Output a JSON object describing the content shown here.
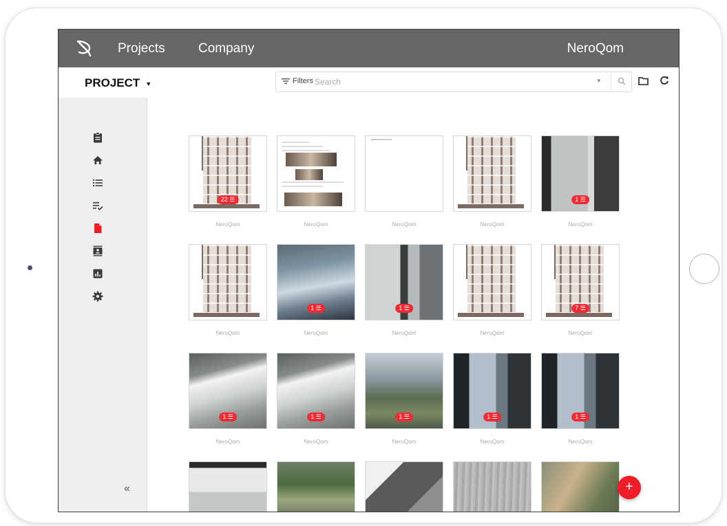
{
  "topbar": {
    "nav": [
      {
        "label": "Projects"
      },
      {
        "label": "Company"
      }
    ],
    "user": "NeroQom"
  },
  "toolbar": {
    "project_label": "PROJECT",
    "filters_label": "Filters",
    "search_placeholder": "Search"
  },
  "sidebar": {
    "icons": [
      "clipboard-icon",
      "home-icon",
      "list-icon",
      "checklist-icon",
      "document-icon",
      "contact-card-icon",
      "chart-icon",
      "gear-icon"
    ],
    "active_icon": "document-icon",
    "collapse_label": "«"
  },
  "grid": {
    "rows": [
      [
        {
          "type": "facade",
          "badge": "22",
          "label": "NeroQom"
        },
        {
          "type": "doc",
          "badge": "",
          "label": "NeroQom"
        },
        {
          "type": "blank",
          "badge": "",
          "label": "NeroQom"
        },
        {
          "type": "facade",
          "badge": "",
          "label": "NeroQom"
        },
        {
          "type": "photo-glass",
          "badge": "1",
          "label": "NeroQom"
        }
      ],
      [
        {
          "type": "facade",
          "badge": "",
          "label": "NeroQom"
        },
        {
          "type": "photo-water",
          "badge": "1",
          "label": "NeroQom"
        },
        {
          "type": "photo-frame",
          "badge": "1",
          "label": "NeroQom"
        },
        {
          "type": "facade",
          "badge": "",
          "label": "NeroQom"
        },
        {
          "type": "facade",
          "badge": "7",
          "label": "NeroQom"
        }
      ],
      [
        {
          "type": "photo-ledge",
          "badge": "1",
          "label": "NeroQom"
        },
        {
          "type": "photo-ledge",
          "badge": "1",
          "label": "NeroQom"
        },
        {
          "type": "photo-window",
          "badge": "1",
          "label": "NeroQom"
        },
        {
          "type": "photo-sky",
          "badge": "1",
          "label": "NeroQom"
        },
        {
          "type": "photo-sky",
          "badge": "1",
          "label": "NeroQom"
        }
      ],
      [
        {
          "type": "photo-metal",
          "badge": "",
          "label": ""
        },
        {
          "type": "photo-green",
          "badge": "",
          "label": ""
        },
        {
          "type": "photo-dark",
          "badge": "",
          "label": ""
        },
        {
          "type": "photo-concrete",
          "badge": "",
          "label": ""
        },
        {
          "type": "photo-aerial",
          "badge": "",
          "label": ""
        }
      ]
    ]
  },
  "fab_label": "+",
  "colors": {
    "topbar": "#666666",
    "accent": "#ef2b35",
    "sidebar_bg": "#efefef"
  }
}
